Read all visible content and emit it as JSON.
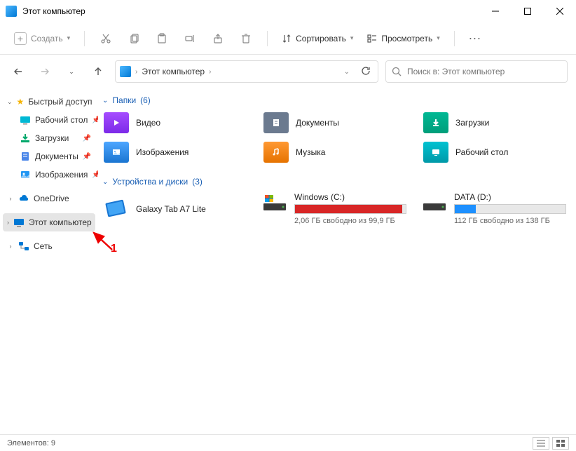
{
  "window": {
    "title": "Этот компьютер"
  },
  "toolbar": {
    "create": "Создать",
    "sort": "Сортировать",
    "view": "Просмотреть"
  },
  "breadcrumb": {
    "root": "Этот компьютер"
  },
  "search": {
    "placeholder": "Поиск в: Этот компьютер"
  },
  "sidebar": {
    "quick": "Быстрый доступ",
    "desktop": "Рабочий стол",
    "downloads": "Загрузки",
    "documents": "Документы",
    "pictures": "Изображения",
    "onedrive": "OneDrive",
    "thispc": "Этот компьютер",
    "network": "Сеть"
  },
  "groups": {
    "folders": {
      "title": "Папки",
      "count": "(6)"
    },
    "devices": {
      "title": "Устройства и диски",
      "count": "(3)"
    }
  },
  "folders": {
    "video": "Видео",
    "documents": "Документы",
    "downloads": "Загрузки",
    "pictures": "Изображения",
    "music": "Музыка",
    "desktop": "Рабочий стол"
  },
  "devices": {
    "tablet": "Galaxy Tab A7 Lite",
    "c": {
      "label": "Windows (C:)",
      "free": "2,06 ГБ свободно из 99,9 ГБ",
      "fillPercent": 97,
      "color": "#d82626"
    },
    "d": {
      "label": "DATA (D:)",
      "free": "112 ГБ свободно из 138 ГБ",
      "fillPercent": 19,
      "color": "#1e90ff"
    }
  },
  "status": {
    "count": "Элементов: 9"
  },
  "annotation": {
    "label": "1"
  }
}
